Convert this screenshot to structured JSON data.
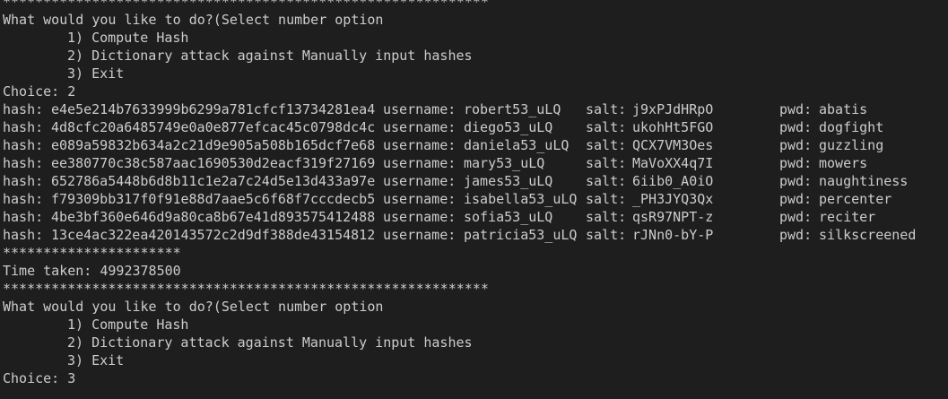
{
  "separator_long": "************************************************************",
  "separator_short": "**********************",
  "session1": {
    "prompt": "What would you like to do?(Select number option",
    "options": [
      "1) Compute Hash",
      "2) Dictionary attack against Manually input hashes",
      "3) Exit"
    ],
    "choice": "Choice: 2"
  },
  "labels": {
    "hash": "hash:",
    "username": "username:",
    "salt": "salt:",
    "pwd": "pwd:"
  },
  "results": [
    {
      "hash": "e4e5e214b7633999b6299a781cfcf13734281ea4",
      "username": "robert53_uLQ",
      "salt": "j9xPJdHRpO",
      "pwd": "abatis"
    },
    {
      "hash": "4d8cfc20a6485749e0a0e877efcac45c0798dc4c",
      "username": "diego53_uLQ",
      "salt": "ukohHt5FGO",
      "pwd": "dogfight"
    },
    {
      "hash": "e089a59832b634a2c21d9e905a508b165dcf7e68",
      "username": "daniela53_uLQ",
      "salt": "QCX7VM3Oes",
      "pwd": "guzzling"
    },
    {
      "hash": "ee380770c38c587aac1690530d2eacf319f27169",
      "username": "mary53_uLQ",
      "salt": "MaVoXX4q7I",
      "pwd": "mowers"
    },
    {
      "hash": "652786a5448b6d8b11c1e2a7c24d5e13d433a97e",
      "username": "james53_uLQ",
      "salt": "6iib0_A0iO",
      "pwd": "naughtiness"
    },
    {
      "hash": "f79309bb317f0f91e88d7aae5c6f68f7cccdecb5",
      "username": "isabella53_uLQ",
      "salt": "_PH3JYQ3Qx",
      "pwd": "percenter"
    },
    {
      "hash": "4be3bf360e646d9a80ca8b67e41d893575412488",
      "username": "sofia53_uLQ",
      "salt": "qsR97NPT-z",
      "pwd": "reciter"
    },
    {
      "hash": "13ce4ac322ea420143572c2d9df388de43154812",
      "username": "patricia53_uLQ",
      "salt": "rJNn0-bY-P",
      "pwd": "silkscreened"
    }
  ],
  "time_taken": "Time taken: 4992378500",
  "session2": {
    "prompt": "What would you like to do?(Select number option",
    "options": [
      "1) Compute Hash",
      "2) Dictionary attack against Manually input hashes",
      "3) Exit"
    ],
    "choice": "Choice: 3"
  },
  "colors": {
    "background": "#1e1e1e",
    "text": "#cccccc"
  }
}
